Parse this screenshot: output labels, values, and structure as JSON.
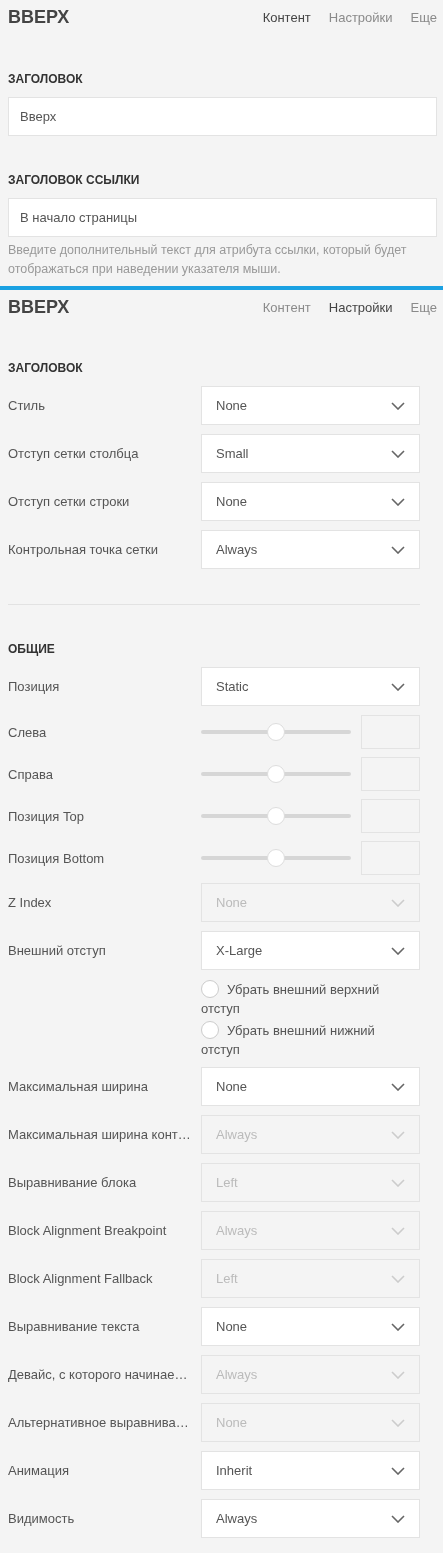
{
  "panels": [
    {
      "title": "ВВЕРХ",
      "tabs": [
        {
          "label": "Контент",
          "selected": true
        },
        {
          "label": "Настройки",
          "selected": false
        },
        {
          "label": "Еще",
          "selected": false
        }
      ],
      "fields": [
        {
          "heading": "ЗАГОЛОВОК",
          "value": "Вверх"
        },
        {
          "heading": "ЗАГОЛОВОК ССЫЛКИ",
          "value": "В начало страницы",
          "help": "Введите дополнительный текст для атрибута ссылки, который будет отображаться при наведении указателя мыши."
        }
      ]
    },
    {
      "title": "ВВЕРХ",
      "tabs": [
        {
          "label": "Контент",
          "selected": false
        },
        {
          "label": "Настройки",
          "selected": true
        },
        {
          "label": "Еще",
          "selected": false
        }
      ],
      "sections": [
        {
          "title": "ЗАГОЛОВОК",
          "rows": [
            {
              "kind": "select",
              "label": "Стиль",
              "value": "None",
              "disabled": false
            },
            {
              "kind": "select",
              "label": "Отступ сетки столбца",
              "value": "Small",
              "disabled": false
            },
            {
              "kind": "select",
              "label": "Отступ сетки строки",
              "value": "None",
              "disabled": false
            },
            {
              "kind": "select",
              "label": "Контрольная точка сетки",
              "value": "Always",
              "disabled": false
            }
          ]
        },
        {
          "title": "ОБЩИЕ",
          "rows": [
            {
              "kind": "select",
              "label": "Позиция",
              "value": "Static",
              "disabled": false
            },
            {
              "kind": "slider",
              "label": "Слева",
              "level": 0.5
            },
            {
              "kind": "slider",
              "label": "Справа",
              "level": 0.5
            },
            {
              "kind": "slider",
              "label": "Позиция Top",
              "level": 0.5
            },
            {
              "kind": "slider",
              "label": "Позиция Bottom",
              "level": 0.5
            },
            {
              "kind": "select",
              "label": "Z Index",
              "value": "None",
              "disabled": true
            },
            {
              "kind": "select",
              "label": "Внешний отступ",
              "value": "X-Large",
              "disabled": false
            },
            {
              "kind": "radio",
              "label": "Убрать внешний верхний отступ",
              "checked": false
            },
            {
              "kind": "radio",
              "label": "Убрать внешний нижний отступ",
              "checked": false
            },
            {
              "kind": "select",
              "label": "Максимальная ширина",
              "value": "None",
              "disabled": false
            },
            {
              "kind": "select",
              "label": "Максимальная ширина конт…",
              "value": "Always",
              "disabled": true
            },
            {
              "kind": "select",
              "label": "Выравнивание блока",
              "value": "Left",
              "disabled": true
            },
            {
              "kind": "select",
              "label": "Block Alignment Breakpoint",
              "value": "Always",
              "disabled": true
            },
            {
              "kind": "select",
              "label": "Block Alignment Fallback",
              "value": "Left",
              "disabled": true
            },
            {
              "kind": "select",
              "label": "Выравнивание текста",
              "value": "None",
              "disabled": false
            },
            {
              "kind": "select",
              "label": "Девайс, с которого начинае…",
              "value": "Always",
              "disabled": true
            },
            {
              "kind": "select",
              "label": "Альтернативное выравнива…",
              "value": "None",
              "disabled": true
            },
            {
              "kind": "select",
              "label": "Анимация",
              "value": "Inherit",
              "disabled": false
            },
            {
              "kind": "select",
              "label": "Видимость",
              "value": "Always",
              "disabled": false
            }
          ]
        }
      ]
    }
  ]
}
